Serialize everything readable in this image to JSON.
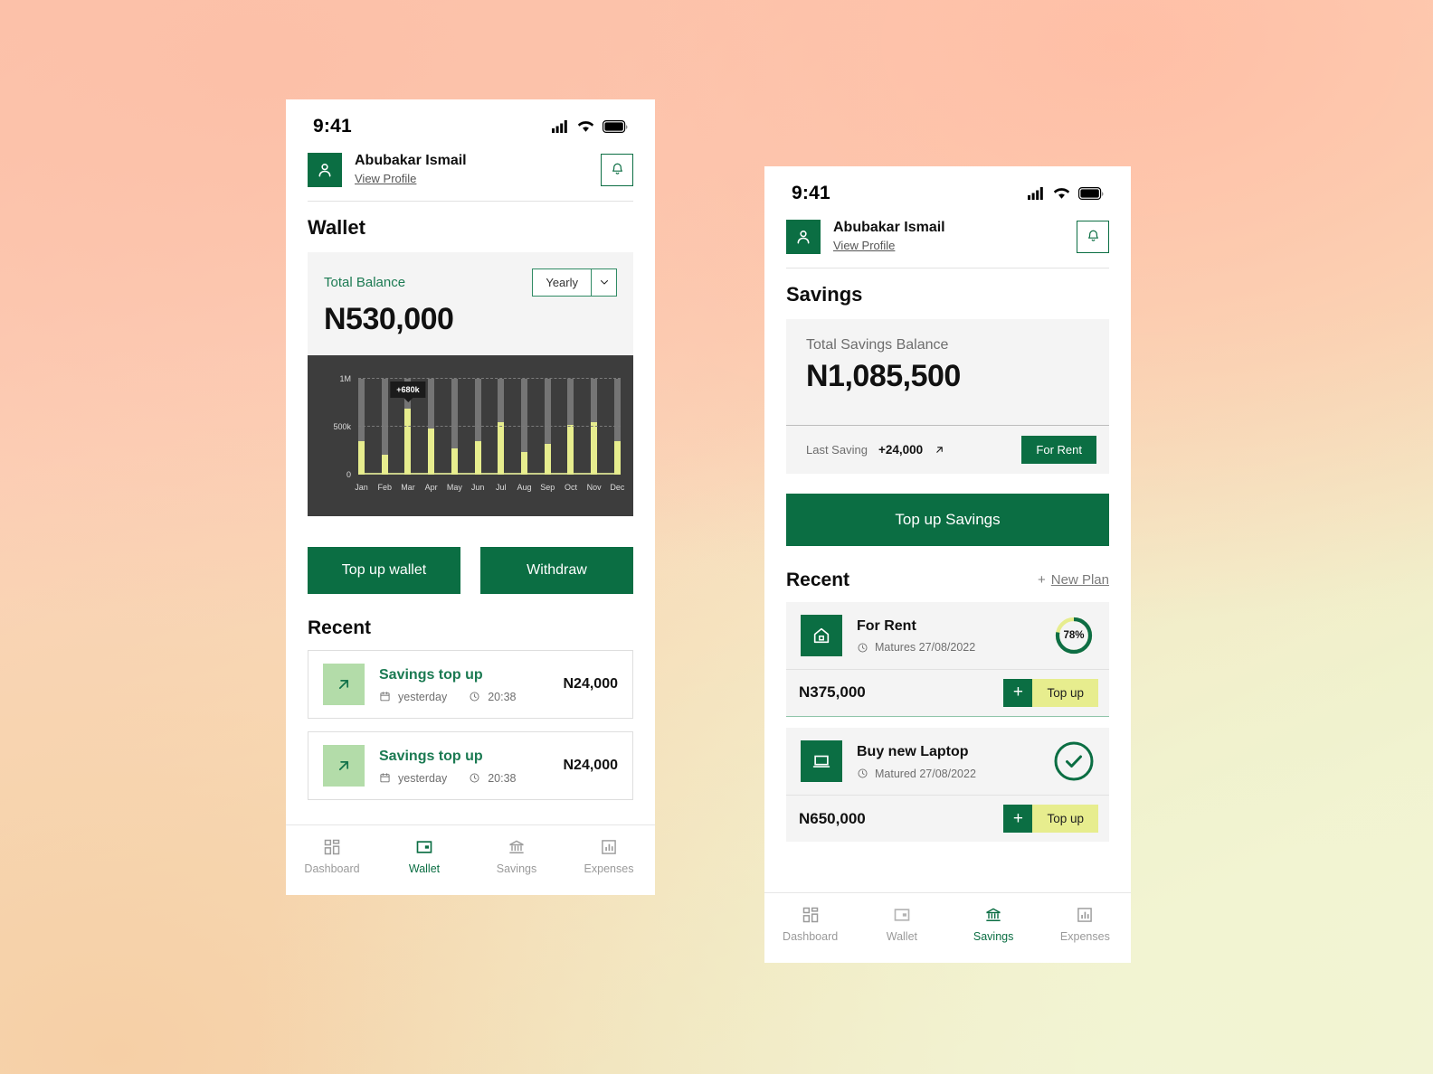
{
  "theme": {
    "brand_green": "#0b6e43",
    "accent_lime": "#e7ed8e",
    "chart_bg": "#3d3d3d",
    "light_green_icon": "#b3dca9"
  },
  "wallet_screen": {
    "status": {
      "time": "9:41",
      "cellular_icon": "signal-bars-icon",
      "wifi_icon": "wifi-icon",
      "battery_icon": "battery-full-icon"
    },
    "profile": {
      "name": "Abubakar Ismail",
      "link": "View Profile",
      "avatar_icon": "user-avatar-icon",
      "bell_icon": "bell-icon"
    },
    "page_title": "Wallet",
    "balance": {
      "label": "Total Balance",
      "amount": "N530,000",
      "period_value": "Yearly",
      "caret_icon": "chevron-down-icon"
    },
    "actions": {
      "topup": "Top up wallet",
      "withdraw": "Withdraw"
    },
    "recent_title": "Recent",
    "transactions": [
      {
        "title": "Savings top up",
        "amount": "N24,000",
        "date": "yesterday",
        "time": "20:38",
        "arrow_icon": "arrow-up-right-icon",
        "calendar_icon": "calendar-icon",
        "clock_icon": "clock-icon"
      },
      {
        "title": "Savings top up",
        "amount": "N24,000",
        "date": "yesterday",
        "time": "20:38",
        "arrow_icon": "arrow-up-right-icon",
        "calendar_icon": "calendar-icon",
        "clock_icon": "clock-icon"
      }
    ],
    "tabs": [
      {
        "label": "Dashboard",
        "icon": "dashboard-grid-icon",
        "active": false
      },
      {
        "label": "Wallet",
        "icon": "wallet-icon",
        "active": true
      },
      {
        "label": "Savings",
        "icon": "bank-icon",
        "active": false
      },
      {
        "label": "Expenses",
        "icon": "bar-chart-icon",
        "active": false
      }
    ]
  },
  "savings_screen": {
    "status": {
      "time": "9:41",
      "cellular_icon": "signal-bars-icon",
      "wifi_icon": "wifi-icon",
      "battery_icon": "battery-full-icon"
    },
    "profile": {
      "name": "Abubakar Ismail",
      "link": "View Profile",
      "avatar_icon": "user-avatar-icon",
      "bell_icon": "bell-icon"
    },
    "page_title": "Savings",
    "balance": {
      "label": "Total Savings Balance",
      "amount": "N1,085,500",
      "last_saving_label": "Last Saving",
      "last_saving_value": "+24,000",
      "last_saving_arrow_icon": "arrow-up-right-icon",
      "chip": "For Rent"
    },
    "topup_button": "Top up Savings",
    "recent_title": "Recent",
    "new_plan": {
      "plus": "+",
      "label": "New Plan"
    },
    "plans": [
      {
        "title": "For Rent",
        "meta": "Matures 27/08/2022",
        "clock_icon": "clock-icon",
        "plan_icon": "house-icon",
        "amount": "N375,000",
        "progress_pct": 78,
        "progress_label": "78%",
        "status": "in-progress",
        "topup_plus": "+",
        "topup_label": "Top up"
      },
      {
        "title": "Buy new Laptop",
        "meta": "Matured 27/08/2022",
        "clock_icon": "clock-icon",
        "plan_icon": "laptop-icon",
        "amount": "N650,000",
        "progress_pct": 100,
        "progress_label": "",
        "status": "complete",
        "check_icon": "check-circle-icon",
        "topup_plus": "+",
        "topup_label": "Top up"
      }
    ],
    "tabs": [
      {
        "label": "Dashboard",
        "icon": "dashboard-grid-icon",
        "active": false
      },
      {
        "label": "Wallet",
        "icon": "wallet-icon",
        "active": false
      },
      {
        "label": "Savings",
        "icon": "bank-icon",
        "active": true
      },
      {
        "label": "Expenses",
        "icon": "bar-chart-icon",
        "active": false
      }
    ]
  },
  "chart_data": {
    "type": "bar",
    "title": "",
    "xlabel": "",
    "ylabel": "",
    "categories": [
      "Jan",
      "Feb",
      "Mar",
      "Apr",
      "May",
      "Jun",
      "Jul",
      "Aug",
      "Sep",
      "Oct",
      "Nov",
      "Dec"
    ],
    "values": [
      340000,
      200000,
      680000,
      480000,
      270000,
      340000,
      545000,
      230000,
      320000,
      510000,
      545000,
      340000
    ],
    "track_max": 1000000,
    "ylim": [
      0,
      1000000
    ],
    "ytick_values": [
      0,
      500000,
      1000000
    ],
    "ytick_labels": [
      "0",
      "500k",
      "1M"
    ],
    "grid": true,
    "legend": "none",
    "annotation": {
      "category": "Mar",
      "text": "+680k"
    },
    "bar_color": "#e7ed8e",
    "track_color": "#757575",
    "background": "#3d3d3d"
  }
}
